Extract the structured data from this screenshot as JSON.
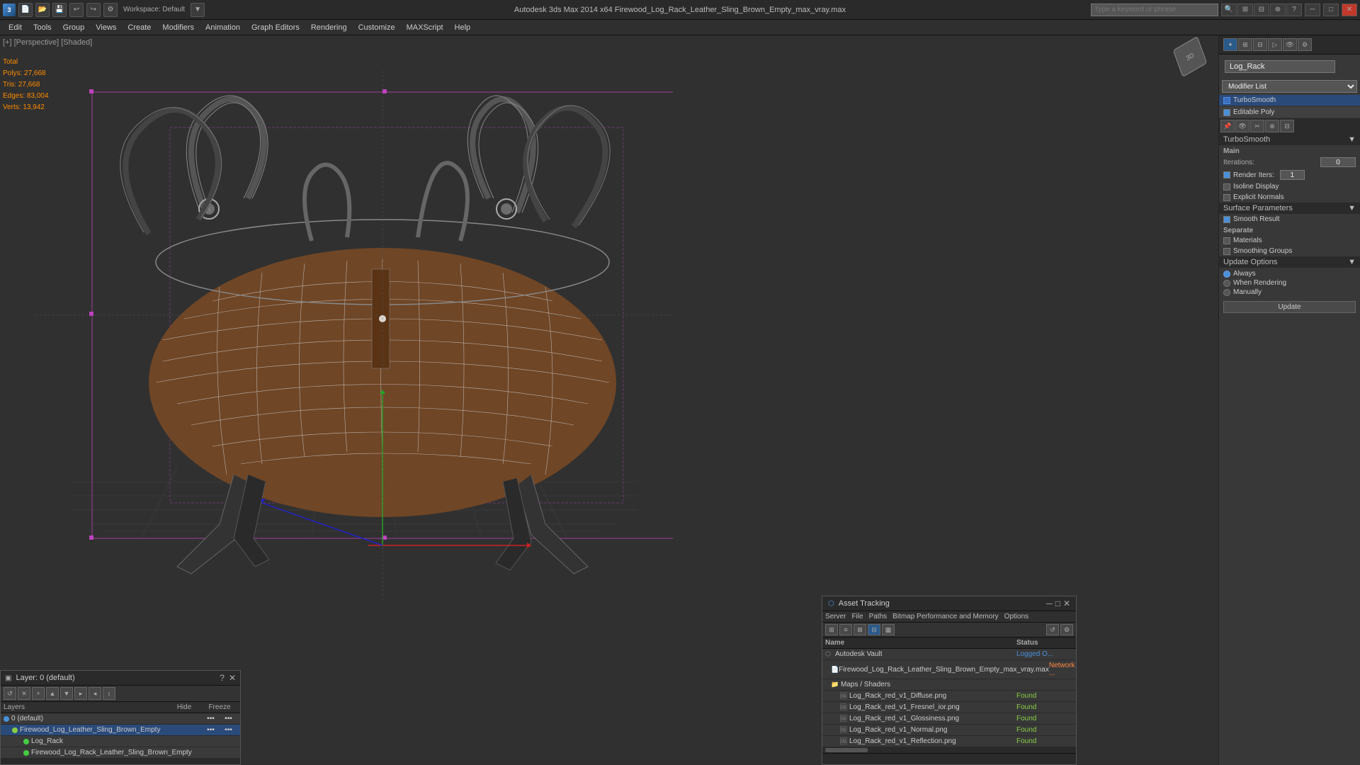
{
  "titlebar": {
    "app_icon": "3",
    "title": "Autodesk 3ds Max 2014 x64    Firewood_Log_Rack_Leather_Sling_Brown_Empty_max_vray.max",
    "search_placeholder": "Type a keyword or phrase",
    "workspace_label": "Workspace: Default",
    "minimize": "─",
    "maximize": "□",
    "close": "✕"
  },
  "menubar": {
    "items": [
      "Edit",
      "Tools",
      "Group",
      "Views",
      "Create",
      "Modifiers",
      "Animation",
      "Graph Editors",
      "Rendering",
      "Customize",
      "MAXScript",
      "Help"
    ]
  },
  "viewport": {
    "label": "[+] [Perspective] [Shaded]",
    "stats": {
      "polys_label": "Polys:",
      "polys_total_label": "Total",
      "polys_value": "27,668",
      "tris_label": "Tris:",
      "tris_value": "27,668",
      "edges_label": "Edges:",
      "edges_value": "83,004",
      "verts_label": "Verts:",
      "verts_value": "13,942"
    }
  },
  "right_panel": {
    "object_name": "Log_Rack",
    "modifier_list_label": "Modifier List",
    "modifiers": [
      {
        "name": "TurboSmooth",
        "active": true
      },
      {
        "name": "Editable Poly",
        "active": false
      }
    ],
    "turbosmooth": {
      "title": "TurboSmooth",
      "main_label": "Main",
      "iterations_label": "Iterations:",
      "iterations_value": "0",
      "render_iters_label": "Render Iters:",
      "render_iters_value": "1",
      "isoline_display_label": "Isoline Display",
      "explicit_normals_label": "Explicit Normals",
      "surface_params_label": "Surface Parameters",
      "smooth_result_label": "Smooth Result",
      "separate_label": "Separate",
      "materials_label": "Materials",
      "smoothing_groups_label": "Smoothing Groups",
      "update_options_label": "Update Options",
      "always_label": "Always",
      "when_rendering_label": "When Rendering",
      "manually_label": "Manually",
      "update_btn": "Update"
    },
    "icon_row": [
      "▣",
      "⊢",
      "⊣",
      "⊤",
      "⊥"
    ]
  },
  "layers_panel": {
    "title": "Layer: 0 (default)",
    "help_btn": "?",
    "close_btn": "✕",
    "columns": {
      "layers": "Layers",
      "hide": "Hide",
      "freeze": "Freeze"
    },
    "toolbar_btns": [
      "↺",
      "✕",
      "+",
      "↑",
      "↓",
      "▸",
      "◂",
      "↕"
    ],
    "items": [
      {
        "indent": 0,
        "type": "layer",
        "name": "0 (default)",
        "hide": "▪▪▪",
        "freeze": "▪▪▪"
      },
      {
        "indent": 1,
        "type": "object",
        "name": "Firewood_Log_Leather_Sling_Brown_Empty",
        "selected": true,
        "hide": "▪▪▪",
        "freeze": "▪▪▪"
      },
      {
        "indent": 2,
        "type": "object",
        "name": "Log_Rack",
        "hide": "",
        "freeze": ""
      },
      {
        "indent": 2,
        "type": "object",
        "name": "Firewood_Log_Rack_Leather_Sling_Brown_Empty",
        "hide": "",
        "freeze": ""
      }
    ]
  },
  "asset_panel": {
    "title": "Asset Tracking",
    "menus": [
      "Server",
      "File",
      "Paths",
      "Bitmap Performance and Memory",
      "Options"
    ],
    "columns": {
      "name": "Name",
      "status": "Status"
    },
    "items": [
      {
        "indent": 0,
        "icon": "vault",
        "name": "Autodesk Vault",
        "status": "Logged O...",
        "status_type": "logged"
      },
      {
        "indent": 1,
        "icon": "file",
        "name": "Firewood_Log_Rack_Leather_Sling_Brown_Empty_max_vray.max",
        "status": "Network ...",
        "status_type": "network"
      },
      {
        "indent": 1,
        "icon": "folder",
        "name": "Maps / Shaders",
        "status": "",
        "status_type": ""
      },
      {
        "indent": 2,
        "icon": "img",
        "name": "Log_Rack_red_v1_Diffuse.png",
        "status": "Found",
        "status_type": "found"
      },
      {
        "indent": 2,
        "icon": "img",
        "name": "Log_Rack_red_v1_Fresnel_ior.png",
        "status": "Found",
        "status_type": "found"
      },
      {
        "indent": 2,
        "icon": "img",
        "name": "Log_Rack_red_v1_Glossiness.png",
        "status": "Found",
        "status_type": "found"
      },
      {
        "indent": 2,
        "icon": "img",
        "name": "Log_Rack_red_v1_Normal.png",
        "status": "Found",
        "status_type": "found"
      },
      {
        "indent": 2,
        "icon": "img",
        "name": "Log_Rack_red_v1_Reflection.png",
        "status": "Found",
        "status_type": "found"
      }
    ]
  }
}
